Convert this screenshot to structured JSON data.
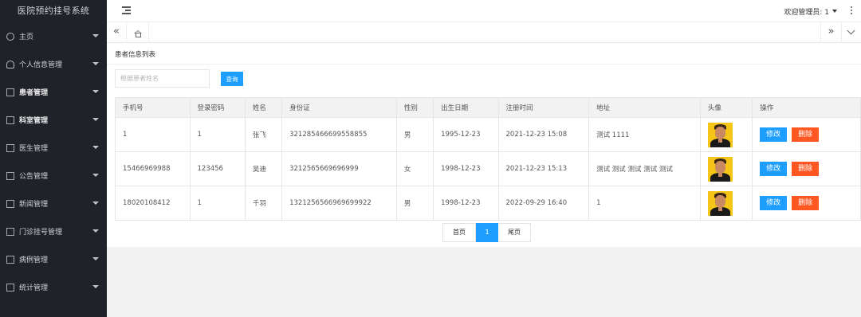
{
  "app": {
    "title": "医院预约挂号系统"
  },
  "sidebar": {
    "items": [
      {
        "label": "主页",
        "icon": "dashboard-icon",
        "bold": false
      },
      {
        "label": "个人信息管理",
        "icon": "user-icon",
        "bold": false
      },
      {
        "label": "患者管理",
        "icon": "file-icon",
        "bold": true
      },
      {
        "label": "科室管理",
        "icon": "file-icon",
        "bold": true
      },
      {
        "label": "医生管理",
        "icon": "file-icon",
        "bold": false
      },
      {
        "label": "公告管理",
        "icon": "file-icon",
        "bold": false
      },
      {
        "label": "新闻管理",
        "icon": "file-icon",
        "bold": false
      },
      {
        "label": "门诊挂号管理",
        "icon": "file-icon",
        "bold": false
      },
      {
        "label": "病例管理",
        "icon": "file-icon",
        "bold": false
      },
      {
        "label": "统计管理",
        "icon": "file-icon",
        "bold": false
      }
    ]
  },
  "header": {
    "welcome": "欢迎管理员: 1"
  },
  "tabs": {
    "left_arrow": "«",
    "right_arrow": "»"
  },
  "card": {
    "title": "患者信息列表"
  },
  "search": {
    "placeholder": "根据患者姓名",
    "value": "",
    "button": "查询"
  },
  "table": {
    "headers": [
      "手机号",
      "登录密码",
      "姓名",
      "身份证",
      "性别",
      "出生日期",
      "注册时间",
      "地址",
      "头像",
      "操作"
    ],
    "rows": [
      {
        "phone": "1",
        "password": "1",
        "name": "张飞",
        "idcard": "321285466699558855",
        "gender": "男",
        "birth": "1995-12-23",
        "registered": "2021-12-23 15:08",
        "address": "测试 1111"
      },
      {
        "phone": "15466969988",
        "password": "123456",
        "name": "吴迪",
        "idcard": "3212565669696999",
        "gender": "女",
        "birth": "1998-12-23",
        "registered": "2021-12-23 15:13",
        "address": "测试 测试 测试 测试 测试"
      },
      {
        "phone": "18020108412",
        "password": "1",
        "name": "千羽",
        "idcard": "1321256566969699922",
        "gender": "男",
        "birth": "1998-12-23",
        "registered": "2022-09-29 16:40",
        "address": "1"
      }
    ],
    "edit_label": "修改",
    "delete_label": "删除"
  },
  "pager": {
    "first": "首页",
    "current": "1",
    "last": "尾页"
  },
  "colors": {
    "sidebar_bg": "#20222a",
    "primary": "#1e9fff",
    "danger": "#ff5722",
    "page_bg": "#f2f2f2"
  }
}
